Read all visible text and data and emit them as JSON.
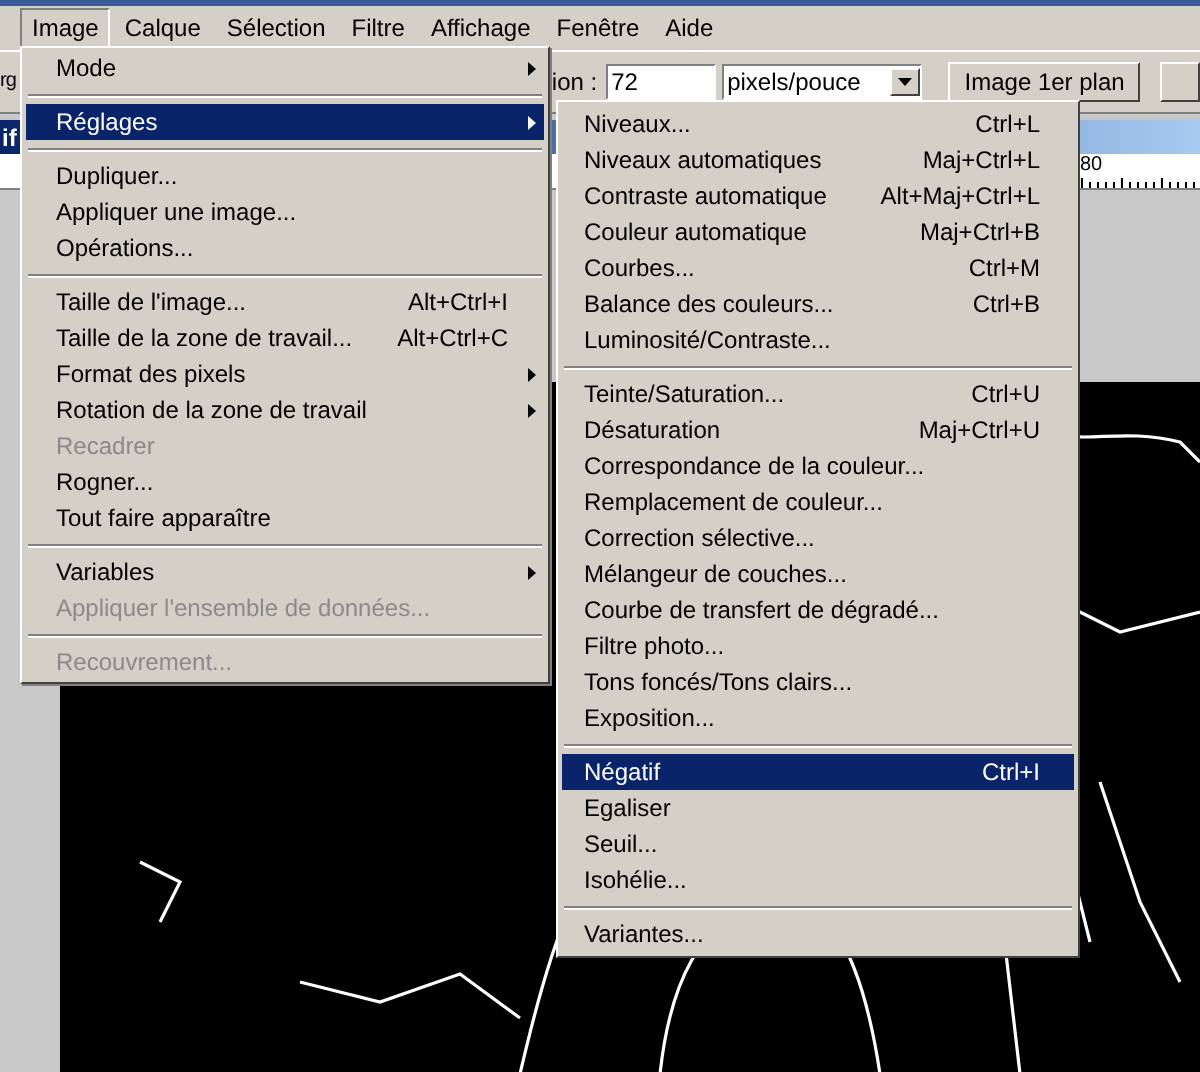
{
  "menu_bar": {
    "items": [
      {
        "label": "Image",
        "selected": true
      },
      {
        "label": "Calque",
        "selected": false
      },
      {
        "label": "Sélection",
        "selected": false
      },
      {
        "label": "Filtre",
        "selected": false
      },
      {
        "label": "Affichage",
        "selected": false
      },
      {
        "label": "Fenêtre",
        "selected": false
      },
      {
        "label": "Aide",
        "selected": false
      }
    ]
  },
  "options_bar": {
    "cut_text": "rg",
    "resolution_label": "ion :",
    "resolution_value": "72",
    "unit": "pixels/pouce",
    "button": "Image 1er plan"
  },
  "document": {
    "title_fragment": "if",
    "ruler_label": "80"
  },
  "image_menu": {
    "items": [
      {
        "kind": "item",
        "label": "Mode",
        "submenu": true,
        "disabled": false,
        "selected": false
      },
      {
        "kind": "separator"
      },
      {
        "kind": "item",
        "label": "Réglages",
        "submenu": true,
        "disabled": false,
        "selected": true
      },
      {
        "kind": "separator"
      },
      {
        "kind": "item",
        "label": "Dupliquer...",
        "submenu": false,
        "disabled": false,
        "selected": false
      },
      {
        "kind": "item",
        "label": "Appliquer une image...",
        "submenu": false,
        "disabled": false,
        "selected": false
      },
      {
        "kind": "item",
        "label": "Opérations...",
        "submenu": false,
        "disabled": false,
        "selected": false
      },
      {
        "kind": "separator"
      },
      {
        "kind": "item",
        "label": "Taille de l'image...",
        "shortcut": "Alt+Ctrl+I",
        "submenu": false,
        "disabled": false,
        "selected": false
      },
      {
        "kind": "item",
        "label": "Taille de la zone de travail...",
        "shortcut": "Alt+Ctrl+C",
        "submenu": false,
        "disabled": false,
        "selected": false
      },
      {
        "kind": "item",
        "label": "Format des pixels",
        "submenu": true,
        "disabled": false,
        "selected": false
      },
      {
        "kind": "item",
        "label": "Rotation de la zone de travail",
        "submenu": true,
        "disabled": false,
        "selected": false
      },
      {
        "kind": "item",
        "label": "Recadrer",
        "submenu": false,
        "disabled": true,
        "selected": false
      },
      {
        "kind": "item",
        "label": "Rogner...",
        "submenu": false,
        "disabled": false,
        "selected": false
      },
      {
        "kind": "item",
        "label": "Tout faire apparaître",
        "submenu": false,
        "disabled": false,
        "selected": false
      },
      {
        "kind": "separator"
      },
      {
        "kind": "item",
        "label": "Variables",
        "submenu": true,
        "disabled": false,
        "selected": false
      },
      {
        "kind": "item",
        "label": "Appliquer l'ensemble de données...",
        "submenu": false,
        "disabled": true,
        "selected": false
      },
      {
        "kind": "separator"
      },
      {
        "kind": "item",
        "label": "Recouvrement...",
        "submenu": false,
        "disabled": true,
        "selected": false
      }
    ]
  },
  "adjustments_submenu": {
    "items": [
      {
        "kind": "item",
        "label": "Niveaux...",
        "shortcut": "Ctrl+L",
        "selected": false
      },
      {
        "kind": "item",
        "label": "Niveaux automatiques",
        "shortcut": "Maj+Ctrl+L",
        "selected": false
      },
      {
        "kind": "item",
        "label": "Contraste automatique",
        "shortcut": "Alt+Maj+Ctrl+L",
        "selected": false
      },
      {
        "kind": "item",
        "label": "Couleur automatique",
        "shortcut": "Maj+Ctrl+B",
        "selected": false
      },
      {
        "kind": "item",
        "label": "Courbes...",
        "shortcut": "Ctrl+M",
        "selected": false
      },
      {
        "kind": "item",
        "label": "Balance des couleurs...",
        "shortcut": "Ctrl+B",
        "selected": false
      },
      {
        "kind": "item",
        "label": "Luminosité/Contraste...",
        "selected": false
      },
      {
        "kind": "separator"
      },
      {
        "kind": "item",
        "label": "Teinte/Saturation...",
        "shortcut": "Ctrl+U",
        "selected": false
      },
      {
        "kind": "item",
        "label": "Désaturation",
        "shortcut": "Maj+Ctrl+U",
        "selected": false
      },
      {
        "kind": "item",
        "label": "Correspondance de la couleur...",
        "selected": false
      },
      {
        "kind": "item",
        "label": "Remplacement de couleur...",
        "selected": false
      },
      {
        "kind": "item",
        "label": "Correction sélective...",
        "selected": false
      },
      {
        "kind": "item",
        "label": "Mélangeur de couches...",
        "selected": false
      },
      {
        "kind": "item",
        "label": "Courbe de transfert de dégradé...",
        "selected": false
      },
      {
        "kind": "item",
        "label": "Filtre photo...",
        "selected": false
      },
      {
        "kind": "item",
        "label": "Tons foncés/Tons clairs...",
        "selected": false
      },
      {
        "kind": "item",
        "label": "Exposition...",
        "selected": false
      },
      {
        "kind": "separator"
      },
      {
        "kind": "item",
        "label": "Négatif",
        "shortcut": "Ctrl+I",
        "selected": true
      },
      {
        "kind": "item",
        "label": "Egaliser",
        "selected": false
      },
      {
        "kind": "item",
        "label": "Seuil...",
        "selected": false
      },
      {
        "kind": "item",
        "label": "Isohélie...",
        "selected": false
      },
      {
        "kind": "separator"
      },
      {
        "kind": "item",
        "label": "Variantes...",
        "selected": false
      }
    ]
  }
}
